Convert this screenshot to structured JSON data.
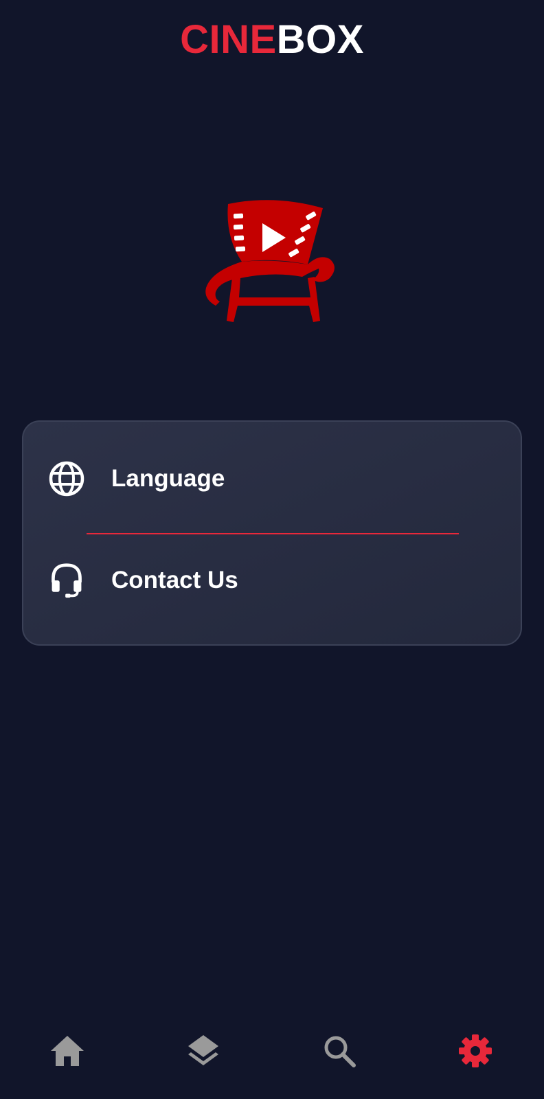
{
  "header": {
    "brand_part1": "CINE",
    "brand_part2": "BOX"
  },
  "colors": {
    "background": "#11152a",
    "accent": "#e8283a",
    "logo_red": "#c40000",
    "card_bg": "#2a2f44",
    "nav_inactive": "#9a9a9a"
  },
  "settings": {
    "items": [
      {
        "icon": "globe-icon",
        "label": "Language"
      },
      {
        "icon": "headset-icon",
        "label": "Contact Us"
      }
    ]
  },
  "bottom_nav": {
    "items": [
      {
        "icon": "home-icon",
        "active": false
      },
      {
        "icon": "layers-icon",
        "active": false
      },
      {
        "icon": "search-icon",
        "active": false
      },
      {
        "icon": "gear-icon",
        "active": true
      }
    ]
  }
}
